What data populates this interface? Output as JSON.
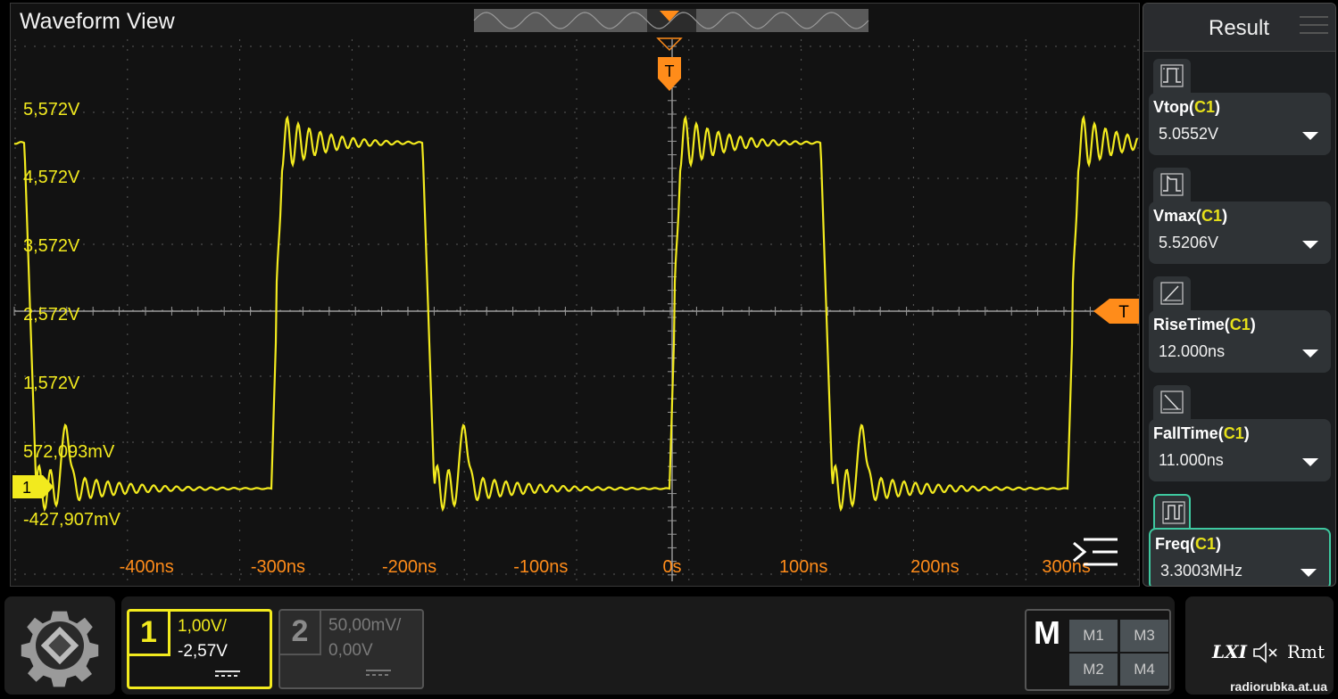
{
  "waveform": {
    "title": "Waveform View",
    "y_labels": [
      "5,572V",
      "4,572V",
      "3,572V",
      "2,572V",
      "1,572V",
      "572,093mV",
      "-427,907mV"
    ],
    "x_labels": [
      "-400ns",
      "-300ns",
      "-200ns",
      "-100ns",
      "0s",
      "100ns",
      "200ns",
      "300ns"
    ],
    "trigger_marker_label": "T",
    "trigger_level_label": "T",
    "channel_marker_label": "1",
    "trace_color": "#f2ea1e",
    "axis_label_color": "#ff8c1a"
  },
  "result": {
    "title": "Result",
    "measurements": [
      {
        "name": "Vtop",
        "channel": "C1",
        "value": "5.0552V"
      },
      {
        "name": "Vmax",
        "channel": "C1",
        "value": "5.5206V"
      },
      {
        "name": "RiseTime",
        "channel": "C1",
        "value": "12.000ns"
      },
      {
        "name": "FallTime",
        "channel": "C1",
        "value": "11.000ns"
      },
      {
        "name": "Freq",
        "channel": "C1",
        "value": "3.3003MHz"
      }
    ]
  },
  "channels": {
    "ch1": {
      "number": "1",
      "scale": "1,00V/",
      "offset": "-2,57V"
    },
    "ch2": {
      "number": "2",
      "scale": "50,00mV/",
      "offset": "0,00V"
    }
  },
  "math": {
    "label": "M",
    "m1": "M1",
    "m2": "M2",
    "m3": "M3",
    "m4": "M4"
  },
  "status": {
    "lxi": "LXI",
    "rmt": "Rmt"
  },
  "watermark": "radiorubka.at.ua"
}
